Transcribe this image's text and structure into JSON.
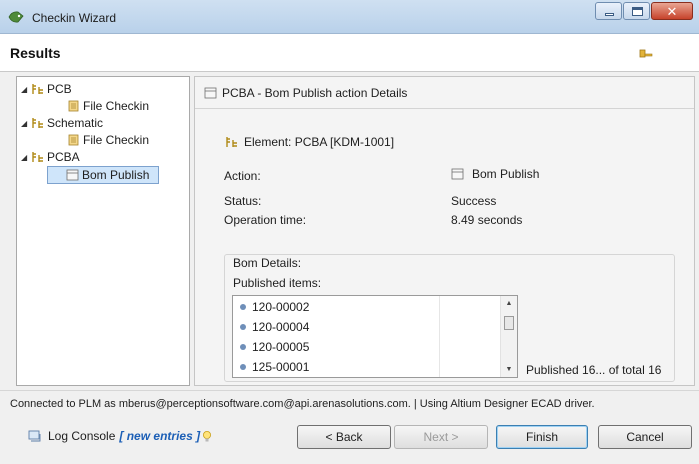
{
  "window": {
    "title": "Checkin Wizard"
  },
  "header": {
    "title": "Results"
  },
  "tree": [
    {
      "label": "PCB",
      "icon": "component-icon",
      "expanded": true
    },
    {
      "label": "File Checkin",
      "icon": "document-icon"
    },
    {
      "label": "Schematic",
      "icon": "component-icon",
      "expanded": true
    },
    {
      "label": "File Checkin",
      "icon": "document-icon"
    },
    {
      "label": "PCBA",
      "icon": "component-icon",
      "expanded": true
    },
    {
      "label": "Bom Publish",
      "icon": "bom-icon",
      "selected": true
    }
  ],
  "details": {
    "title": "PCBA - Bom Publish action Details",
    "element": "Element: PCBA [KDM-1001]",
    "action_label": "Action:",
    "action_value": "Bom Publish",
    "status_label": "Status:",
    "status_value": "Success",
    "time_label": "Operation time:",
    "time_value": "8.49 seconds",
    "bom_legend": "Bom Details:",
    "published_label": "Published items:",
    "published_items": [
      "120-00002",
      "120-00004",
      "120-00005",
      "125-00001"
    ],
    "published_summary": "Published 16... of total 16"
  },
  "status": {
    "text": "Connected to PLM as mberus@perceptionsoftware.com@api.arenasolutions.com.  |  Using Altium Designer ECAD driver."
  },
  "footer": {
    "log_label": "Log Console",
    "log_new": "[ new entries ]",
    "back": "< Back",
    "next": "Next >",
    "finish": "Finish",
    "cancel": "Cancel"
  },
  "colors": {
    "selection": "#cfe5fa",
    "accent": "#1c5fb6",
    "close": "#c7432b"
  }
}
